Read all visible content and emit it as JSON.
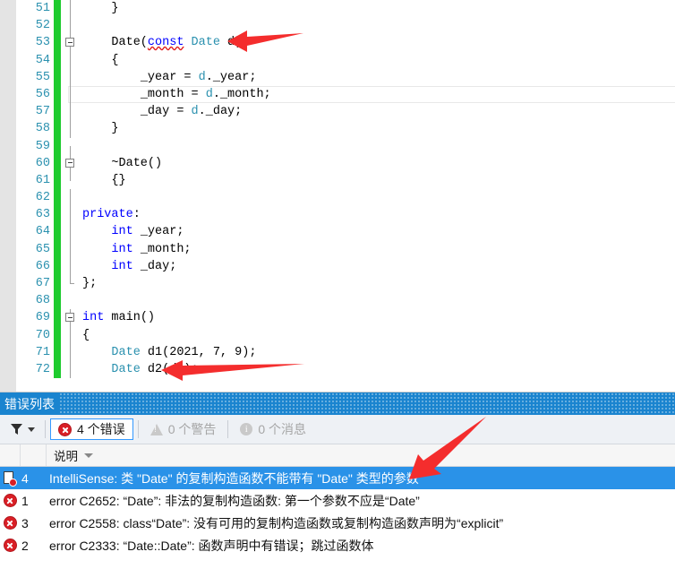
{
  "editor": {
    "first_line": 51,
    "lines": [
      {
        "num": 51,
        "indent": 4,
        "tokens": [
          {
            "t": "}",
            "c": "pln"
          }
        ],
        "fold": "line",
        "changed": true
      },
      {
        "num": 52,
        "indent": 0,
        "tokens": [],
        "fold": "line",
        "changed": true
      },
      {
        "num": 53,
        "indent": 4,
        "tokens": [
          {
            "t": "Date(",
            "c": "pln"
          },
          {
            "t": "const",
            "c": "kw squiggle"
          },
          {
            "t": " ",
            "c": "pln"
          },
          {
            "t": "Date",
            "c": "typ"
          },
          {
            "t": " d)",
            "c": "pln"
          }
        ],
        "fold": "box",
        "changed": true
      },
      {
        "num": 54,
        "indent": 4,
        "tokens": [
          {
            "t": "{",
            "c": "pln"
          }
        ],
        "fold": "line",
        "changed": true
      },
      {
        "num": 55,
        "indent": 8,
        "tokens": [
          {
            "t": "_year = ",
            "c": "pln"
          },
          {
            "t": "d",
            "c": "typ"
          },
          {
            "t": "._year;",
            "c": "pln"
          }
        ],
        "fold": "line",
        "changed": true
      },
      {
        "num": 56,
        "indent": 8,
        "tokens": [
          {
            "t": "_month = ",
            "c": "pln"
          },
          {
            "t": "d",
            "c": "typ"
          },
          {
            "t": "._month;",
            "c": "pln"
          }
        ],
        "fold": "line",
        "changed": true,
        "current": true
      },
      {
        "num": 57,
        "indent": 8,
        "tokens": [
          {
            "t": "_day = ",
            "c": "pln"
          },
          {
            "t": "d",
            "c": "typ"
          },
          {
            "t": "._day;",
            "c": "pln"
          }
        ],
        "fold": "line",
        "changed": true
      },
      {
        "num": 58,
        "indent": 4,
        "tokens": [
          {
            "t": "}",
            "c": "pln"
          }
        ],
        "fold": "line",
        "changed": true
      },
      {
        "num": 59,
        "indent": 0,
        "tokens": [],
        "fold": "half-top",
        "changed": true
      },
      {
        "num": 60,
        "indent": 4,
        "tokens": [
          {
            "t": "~Date()",
            "c": "pln"
          }
        ],
        "fold": "box",
        "changed": true
      },
      {
        "num": 61,
        "indent": 4,
        "tokens": [
          {
            "t": "{}",
            "c": "pln"
          }
        ],
        "fold": "half-bottom",
        "changed": true
      },
      {
        "num": 62,
        "indent": 0,
        "tokens": [],
        "fold": "line",
        "changed": true
      },
      {
        "num": 63,
        "indent": 0,
        "tokens": [
          {
            "t": "private",
            "c": "kw"
          },
          {
            "t": ":",
            "c": "pln"
          }
        ],
        "fold": "line",
        "changed": true
      },
      {
        "num": 64,
        "indent": 4,
        "tokens": [
          {
            "t": "int",
            "c": "kw"
          },
          {
            "t": " _year;",
            "c": "pln"
          }
        ],
        "fold": "line",
        "changed": true
      },
      {
        "num": 65,
        "indent": 4,
        "tokens": [
          {
            "t": "int",
            "c": "kw"
          },
          {
            "t": " _month;",
            "c": "pln"
          }
        ],
        "fold": "line",
        "changed": true
      },
      {
        "num": 66,
        "indent": 4,
        "tokens": [
          {
            "t": "int",
            "c": "kw"
          },
          {
            "t": " _day;",
            "c": "pln"
          }
        ],
        "fold": "line",
        "changed": true
      },
      {
        "num": 67,
        "indent": 0,
        "tokens": [
          {
            "t": "};",
            "c": "pln"
          }
        ],
        "fold": "end",
        "changed": true
      },
      {
        "num": 68,
        "indent": 0,
        "tokens": [],
        "fold": "none",
        "changed": true
      },
      {
        "num": 69,
        "indent": 0,
        "tokens": [
          {
            "t": "int",
            "c": "kw"
          },
          {
            "t": " main()",
            "c": "pln"
          }
        ],
        "fold": "box",
        "changed": true
      },
      {
        "num": 70,
        "indent": 0,
        "tokens": [
          {
            "t": "{",
            "c": "pln"
          }
        ],
        "fold": "line",
        "changed": true
      },
      {
        "num": 71,
        "indent": 4,
        "tokens": [
          {
            "t": "Date",
            "c": "typ"
          },
          {
            "t": " d1(2021, 7, 9);",
            "c": "pln"
          }
        ],
        "fold": "line",
        "changed": true
      },
      {
        "num": 72,
        "indent": 4,
        "tokens": [
          {
            "t": "Date",
            "c": "typ"
          },
          {
            "t": " d2(d1);",
            "c": "pln"
          }
        ],
        "fold": "line",
        "changed": true
      }
    ]
  },
  "error_panel": {
    "title": "错误列表",
    "toolbar": {
      "filter_icon": "funnel-icon",
      "filter_caret_icon": "chevron-down-icon",
      "errors_label": "4 个错误",
      "errors_icon": "error-icon",
      "warnings_label": "0 个警告",
      "warnings_icon": "warning-icon",
      "messages_label": "0 个消息",
      "messages_icon": "info-icon"
    },
    "columns": {
      "icon": "",
      "number": "",
      "description": "说明",
      "sort_icon": "sort-descending-caret-icon"
    },
    "rows": [
      {
        "icon": "intellisense-doc-error-icon",
        "num": "4",
        "description": "IntelliSense: 类 \"Date\" 的复制构造函数不能带有 \"Date\" 类型的参数",
        "selected": true
      },
      {
        "icon": "error-icon",
        "num": "1",
        "description": "error C2652: “Date”: 非法的复制构造函数: 第一个参数不应是“Date”",
        "selected": false
      },
      {
        "icon": "error-icon",
        "num": "3",
        "description": "error C2558: class“Date”: 没有可用的复制构造函数或复制构造函数声明为“explicit”",
        "selected": false
      },
      {
        "icon": "error-icon",
        "num": "2",
        "description": "error C2333: “Date::Date”: 函数声明中有错误；跳过函数体",
        "selected": false
      }
    ]
  },
  "annotations": {
    "arrow_color": "#f42d2d",
    "arrows": [
      {
        "name": "arrow-to-copy-ctor-param",
        "points_at": "line 53 Date(const Date d)"
      },
      {
        "name": "arrow-to-d2-construction",
        "points_at": "line 72 Date d2(d1);"
      },
      {
        "name": "arrow-to-selected-error",
        "points_at": "IntelliSense error row"
      }
    ]
  },
  "colors": {
    "accent_blue": "#1a84cf",
    "selection_blue": "#2a92e8",
    "keyword_blue": "#0000ff",
    "type_teal": "#2b91af",
    "change_bar_green": "#1ecb2e",
    "error_red": "#d91f26",
    "annotation_red": "#f42d2d"
  }
}
